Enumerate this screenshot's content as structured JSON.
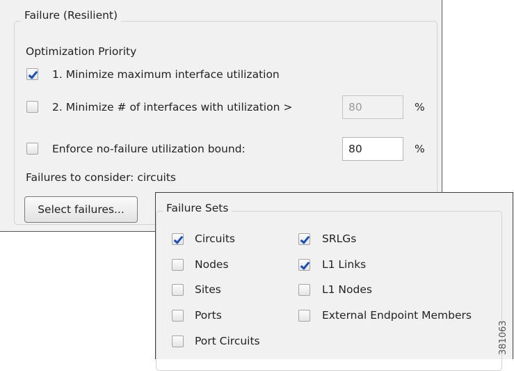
{
  "failure_group": {
    "title": "Failure (Resilient)",
    "optimization_priority_label": "Optimization Priority",
    "option1": {
      "label": "1. Minimize maximum interface utilization",
      "checked": true
    },
    "option2": {
      "label": "2. Minimize # of interfaces with utilization >",
      "checked": false,
      "value": "80",
      "unit": "%"
    },
    "enforce": {
      "label": "Enforce no-failure utilization bound:",
      "checked": false,
      "value": "80",
      "unit": "%"
    },
    "failures_to_consider": "Failures to consider:  circuits",
    "select_button": "Select failures..."
  },
  "failure_sets": {
    "title": "Failure Sets",
    "left": [
      {
        "label": "Circuits",
        "checked": true
      },
      {
        "label": "Nodes",
        "checked": false
      },
      {
        "label": "Sites",
        "checked": false
      },
      {
        "label": "Ports",
        "checked": false
      },
      {
        "label": "Port Circuits",
        "checked": false
      }
    ],
    "right": [
      {
        "label": "SRLGs",
        "checked": true
      },
      {
        "label": "L1 Links",
        "checked": true
      },
      {
        "label": "L1 Nodes",
        "checked": false
      },
      {
        "label": "External Endpoint Members",
        "checked": false
      }
    ]
  },
  "figure_id": "381063"
}
